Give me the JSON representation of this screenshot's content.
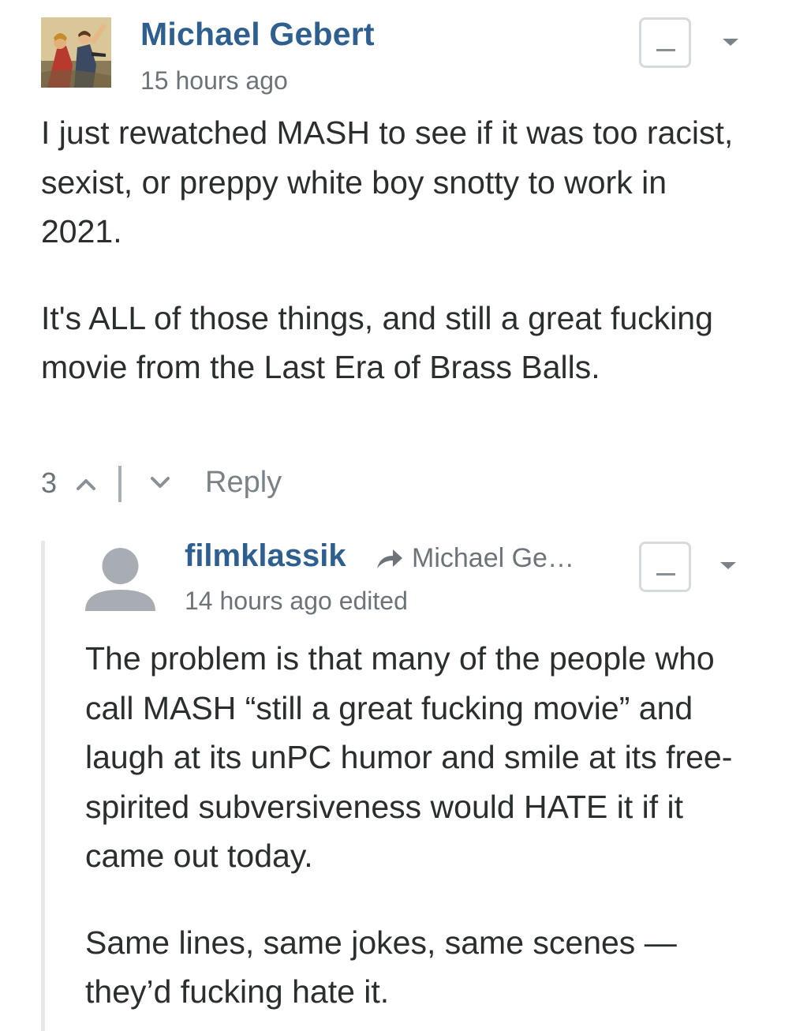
{
  "comments": [
    {
      "author": "Michael Gebert",
      "timestamp": "15 hours ago",
      "paragraphs": [
        "I just rewatched MASH to see if it was too racist, sexist, or preppy white boy snotty to work in 2021.",
        "It's ALL of those things, and still a great fucking movie from the Last Era of Brass Balls."
      ],
      "upvotes": "3",
      "reply_label": "Reply",
      "collapse_label": "—"
    },
    {
      "author": "filmklassik",
      "in_reply_to": "Michael Ge…",
      "timestamp": "14 hours ago edited",
      "paragraphs": [
        "The problem is that many of the people who call MASH “still a great fucking movie” and laugh at its unPC humor and smile at its free-spirited subversiveness would HATE it if it came out today.",
        "Same lines, same jokes, same scenes — they’d fucking hate it."
      ],
      "collapse_label": "—"
    }
  ],
  "colors": {
    "author": "#2e5f8f",
    "meta": "#6c7479",
    "body": "#2a2e2e",
    "thread_line": "#e6e8ea"
  }
}
